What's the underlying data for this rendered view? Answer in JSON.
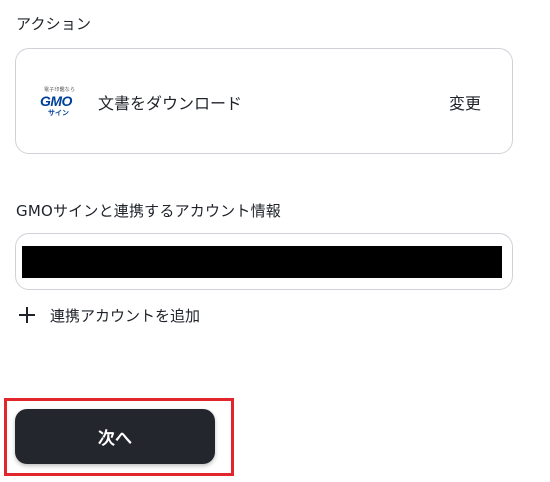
{
  "action": {
    "section_label": "アクション",
    "logo": {
      "tagline": "電子印鑑なら",
      "brand": "GMO",
      "sub": "サイン"
    },
    "title": "文書をダウンロード",
    "change_label": "変更"
  },
  "account": {
    "section_label": "GMOサインと連携するアカウント情報",
    "value": "",
    "add_label": "連携アカウントを追加"
  },
  "footer": {
    "next_label": "次へ"
  },
  "colors": {
    "button_bg": "#23262d",
    "highlight": "#e3262b",
    "logo_blue": "#004098"
  }
}
